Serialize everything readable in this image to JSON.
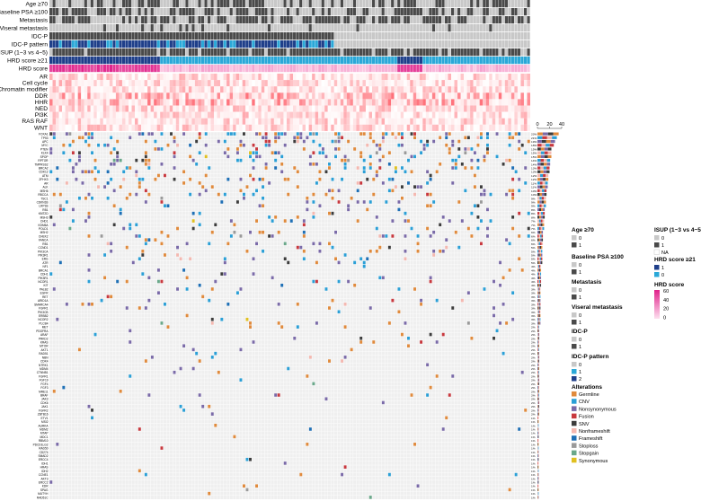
{
  "chart_data": {
    "type": "heatmap",
    "title": "",
    "n_samples": 152,
    "clinical_tracks": [
      {
        "label": "Age ≥70",
        "legend_title": "Age ≥70",
        "palette": [
          "#c8c8c8",
          "#4a4a4a"
        ],
        "legend_values": [
          "0",
          "1"
        ]
      },
      {
        "label": "Baseline PSA ≥100",
        "legend_title": "Baseline PSA ≥100",
        "palette": [
          "#c8c8c8",
          "#4a4a4a"
        ],
        "legend_values": [
          "0",
          "1"
        ]
      },
      {
        "label": "Metastasis",
        "legend_title": "Metastasis",
        "palette": [
          "#c8c8c8",
          "#4a4a4a"
        ],
        "legend_values": [
          "0",
          "1"
        ]
      },
      {
        "label": "Viseral metastasis",
        "legend_title": "Viseral metastasis",
        "palette": [
          "#c8c8c8",
          "#4a4a4a"
        ],
        "legend_values": [
          "0",
          "1"
        ]
      },
      {
        "label": "IDC-P",
        "legend_title": "IDC-P",
        "palette": [
          "#c8c8c8",
          "#4a4a4a"
        ],
        "legend_values": [
          "0",
          "1"
        ]
      },
      {
        "label": "IDC-P pattern",
        "legend_title": "IDC-P pattern",
        "palette": [
          "#c8c8c8",
          "#2aa8d8",
          "#1f3f8a"
        ],
        "legend_values": [
          "0",
          "1",
          "2"
        ]
      },
      {
        "label": "ISUP (1~3 vs 4~5)",
        "legend_title": "ISUP (1~3 vs 4~5)",
        "palette": [
          "#c8c8c8",
          "#4a4a4a",
          "#ffffff"
        ],
        "legend_values": [
          "0",
          "1",
          "NA"
        ]
      },
      {
        "label": "HRD score ≥21",
        "legend_title": "HRD score ≥21",
        "palette": [
          "#1f3f8a",
          "#2aa8d8"
        ],
        "legend_values": [
          "1",
          "0"
        ]
      },
      {
        "label": "HRD score",
        "legend_title": "HRD score",
        "gradient": [
          "#fde0ef",
          "#e0218a"
        ],
        "legend_ticks": [
          "60",
          "40",
          "20",
          "0"
        ]
      }
    ],
    "pathways": [
      "AR",
      "Cell cycle",
      "Chromatin modifier",
      "DDR",
      "HHR",
      "NED",
      "PI3K",
      "RAS RAF",
      "WNT"
    ],
    "pathway_color": "#e8414f",
    "alteration_types": [
      {
        "name": "Germline",
        "color": "#e08a3c"
      },
      {
        "name": "CNV",
        "color": "#2a9fd6"
      },
      {
        "name": "Nonsynonymous",
        "color": "#7a6aa8"
      },
      {
        "name": "Fusion",
        "color": "#c8383e"
      },
      {
        "name": "SNV",
        "color": "#3c3c3c"
      },
      {
        "name": "Nonframeshift",
        "color": "#f4b8b0"
      },
      {
        "name": "Frameshift",
        "color": "#1e6fb5"
      },
      {
        "name": "Stoploss",
        "color": "#9a9a9a"
      },
      {
        "name": "Stopgain",
        "color": "#6aa88a"
      },
      {
        "name": "Synonymous",
        "color": "#e0c020"
      }
    ],
    "genes": [
      {
        "name": "FOXA1",
        "pct": "23%"
      },
      {
        "name": "TP53",
        "pct": "21%"
      },
      {
        "name": "APC",
        "pct": "19%"
      },
      {
        "name": "MYC",
        "pct": "18%"
      },
      {
        "name": "PTEN",
        "pct": "15%"
      },
      {
        "name": "KLK4",
        "pct": "15%"
      },
      {
        "name": "SPOP",
        "pct": "15%"
      },
      {
        "name": "RPTOR",
        "pct": "14%"
      },
      {
        "name": "TMPRSS2",
        "pct": "14%"
      },
      {
        "name": "BRCA2",
        "pct": "13%"
      },
      {
        "name": "CDK12",
        "pct": "13%"
      },
      {
        "name": "ATM",
        "pct": "12%"
      },
      {
        "name": "ZFHX3",
        "pct": "12%"
      },
      {
        "name": "AR",
        "pct": "11%"
      },
      {
        "name": "ALK",
        "pct": "11%"
      },
      {
        "name": "MSH6",
        "pct": "10%"
      },
      {
        "name": "RBCCA",
        "pct": "10%"
      },
      {
        "name": "TSC1",
        "pct": "9%"
      },
      {
        "name": "CDKN1B",
        "pct": "9%"
      },
      {
        "name": "LRP1B",
        "pct": "9%"
      },
      {
        "name": "RB1",
        "pct": "8%"
      },
      {
        "name": "KMT2D",
        "pct": "8%"
      },
      {
        "name": "MSH3",
        "pct": "8%"
      },
      {
        "name": "CHD1",
        "pct": "7%"
      },
      {
        "name": "KDM6A",
        "pct": "7%"
      },
      {
        "name": "POLD1",
        "pct": "7%"
      },
      {
        "name": "MSH2",
        "pct": "6%"
      },
      {
        "name": "CHEK2",
        "pct": "6%"
      },
      {
        "name": "FANCA",
        "pct": "6%"
      },
      {
        "name": "RB1",
        "pct": "6%"
      },
      {
        "name": "CCND1",
        "pct": "5%"
      },
      {
        "name": "PIK3CA",
        "pct": "5%"
      },
      {
        "name": "PIK3R1",
        "pct": "5%"
      },
      {
        "name": "ERG",
        "pct": "5%"
      },
      {
        "name": "ATR",
        "pct": "5%"
      },
      {
        "name": "NF1",
        "pct": "4%"
      },
      {
        "name": "BRCA1",
        "pct": "4%"
      },
      {
        "name": "CDH1",
        "pct": "4%"
      },
      {
        "name": "PIK3R1",
        "pct": "4%"
      },
      {
        "name": "NCOR1",
        "pct": "4%"
      },
      {
        "name": "KIT",
        "pct": "4%"
      },
      {
        "name": "PALB2",
        "pct": "3%"
      },
      {
        "name": "EGFR",
        "pct": "3%"
      },
      {
        "name": "RET",
        "pct": "3%"
      },
      {
        "name": "ARID1A",
        "pct": "3%"
      },
      {
        "name": "SMARCA4",
        "pct": "3%"
      },
      {
        "name": "FGFR1",
        "pct": "3%"
      },
      {
        "name": "PIK3CB",
        "pct": "3%"
      },
      {
        "name": "ERBB2",
        "pct": "3%"
      },
      {
        "name": "NCOR2",
        "pct": "3%"
      },
      {
        "name": "PLCB4",
        "pct": "3%"
      },
      {
        "name": "MET",
        "pct": "2%"
      },
      {
        "name": "PDGFRA",
        "pct": "2%"
      },
      {
        "name": "ARAF",
        "pct": "2%"
      },
      {
        "name": "PRKD2",
        "pct": "2%"
      },
      {
        "name": "KRAS",
        "pct": "2%"
      },
      {
        "name": "MTOR",
        "pct": "2%"
      },
      {
        "name": "AKT1",
        "pct": "2%"
      },
      {
        "name": "RAD51",
        "pct": "2%"
      },
      {
        "name": "NBN",
        "pct": "2%"
      },
      {
        "name": "CDK4",
        "pct": "2%"
      },
      {
        "name": "NTRK1",
        "pct": "2%"
      },
      {
        "name": "MDM4",
        "pct": "2%"
      },
      {
        "name": "CTNNB1",
        "pct": "2%"
      },
      {
        "name": "FGFR1",
        "pct": "2%"
      },
      {
        "name": "FGF19",
        "pct": "2%"
      },
      {
        "name": "FGF4",
        "pct": "2%"
      },
      {
        "name": "FGF3",
        "pct": "2%"
      },
      {
        "name": "MRE11",
        "pct": "2%"
      },
      {
        "name": "BRAF",
        "pct": "2%"
      },
      {
        "name": "JAK3",
        "pct": "2%"
      },
      {
        "name": "CDK6",
        "pct": "2%"
      },
      {
        "name": "JAK1",
        "pct": "2%"
      },
      {
        "name": "FGFR2",
        "pct": "2%"
      },
      {
        "name": "ZBTB16",
        "pct": "2%"
      },
      {
        "name": "ETV1",
        "pct": "1%"
      },
      {
        "name": "MSI2",
        "pct": "1%"
      },
      {
        "name": "AURKA",
        "pct": "1%"
      },
      {
        "name": "MDM2",
        "pct": "1%"
      },
      {
        "name": "MTAP",
        "pct": "1%"
      },
      {
        "name": "MDC1",
        "pct": "1%"
      },
      {
        "name": "RBM10",
        "pct": "1%"
      },
      {
        "name": "PDCD1LG2",
        "pct": "1%"
      },
      {
        "name": "RAD50",
        "pct": "1%"
      },
      {
        "name": "CD274",
        "pct": "1%"
      },
      {
        "name": "SMAD2",
        "pct": "1%"
      },
      {
        "name": "ERCC4",
        "pct": "1%"
      },
      {
        "name": "IDH1",
        "pct": "1%"
      },
      {
        "name": "HRAS",
        "pct": "1%"
      },
      {
        "name": "IDH2",
        "pct": "1%"
      },
      {
        "name": "CCNE1",
        "pct": "1%"
      },
      {
        "name": "AKT3",
        "pct": "1%"
      },
      {
        "name": "ERCC2",
        "pct": "1%"
      },
      {
        "name": "KDR",
        "pct": "1%"
      },
      {
        "name": "SPAG",
        "pct": "1%"
      },
      {
        "name": "MUTYH",
        "pct": "1%"
      },
      {
        "name": "RAD51C",
        "pct": "1%"
      }
    ],
    "bar_axis_ticks": [
      "0",
      "20",
      "40"
    ],
    "bar_xlim": [
      0,
      40
    ],
    "grid": true,
    "legend_placement": "right"
  }
}
